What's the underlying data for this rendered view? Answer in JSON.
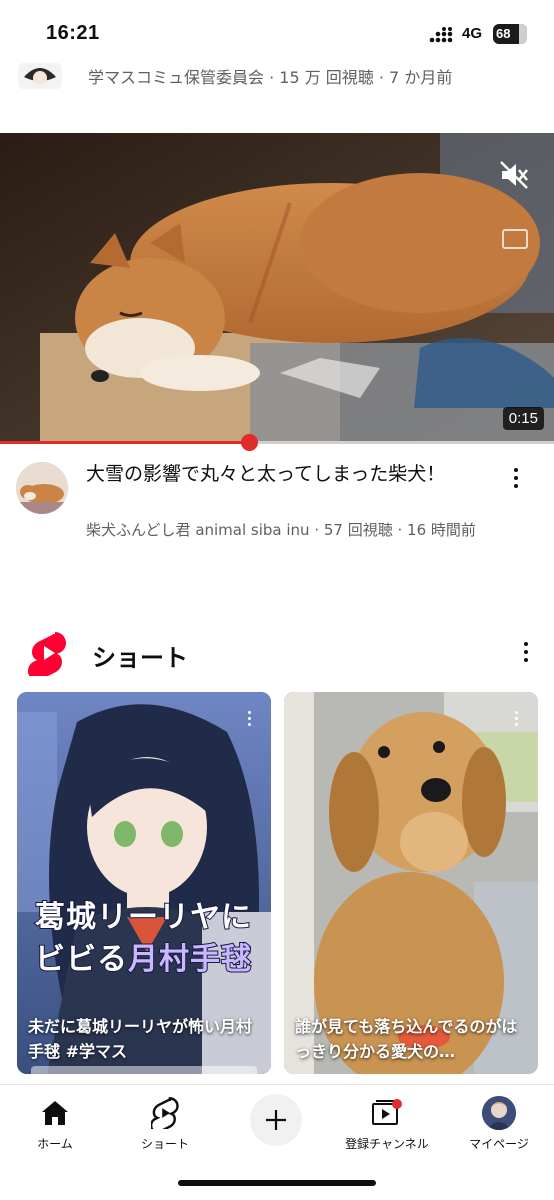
{
  "status_bar": {
    "time": "16:21",
    "network": "4G",
    "battery": "68"
  },
  "previous_video": {
    "meta": "学マスコミュ保管委員会 · 15 万 回視聴 · 7 か月前"
  },
  "video": {
    "duration": "0:15",
    "progress": 0.45,
    "muted": true,
    "title": "大雪の影響で丸々と太ってしまった柴犬！",
    "meta": "柴犬ふんどし君 animal siba inu · 57 回視聴 · 16 時間前"
  },
  "shorts": {
    "section_label": "ショート",
    "items": [
      {
        "overlay_line1": "葛城リーリヤに",
        "overlay_line2_a": "ビビる",
        "overlay_line2_b": "月村手毬",
        "caption": "未だに葛城リーリヤが怖い月村手毬 #学マス"
      },
      {
        "caption": "誰が見ても落ち込んでるのがはっきり分かる愛犬の…"
      }
    ]
  },
  "bottom_nav": {
    "home": "ホーム",
    "shorts": "ショート",
    "subscriptions": "登録チャンネル",
    "you": "マイページ"
  },
  "colors": {
    "accent_red": "#e22b2b",
    "text_primary": "#0f0f0f",
    "text_secondary": "#606060"
  }
}
